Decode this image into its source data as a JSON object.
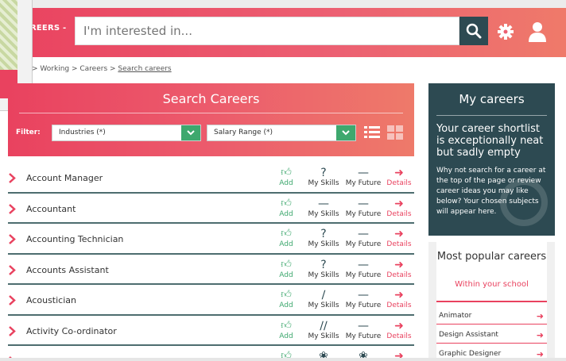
{
  "header": {
    "nav_label": "REERS -",
    "search_placeholder": "I'm interested in..."
  },
  "breadcrumb": {
    "text": "> Working > Careers > ",
    "current": "Search careers"
  },
  "search_panel": {
    "title": "Search Careers",
    "filter_label": "Filter:",
    "industries_select": "Industries (*)",
    "salary_select": "Salary Range (*)"
  },
  "careers": [
    {
      "name": "Account Manager",
      "skills": "?",
      "future": "—"
    },
    {
      "name": "Accountant",
      "skills": "—",
      "future": "—"
    },
    {
      "name": "Accounting Technician",
      "skills": "?",
      "future": "—"
    },
    {
      "name": "Accounts Assistant",
      "skills": "?",
      "future": "—"
    },
    {
      "name": "Acoustician",
      "skills": "∕",
      "future": "—"
    },
    {
      "name": "Activity Co-ordinator",
      "skills": "∕∕",
      "future": "—"
    },
    {
      "name": "",
      "skills": "❀",
      "future": "❀"
    }
  ],
  "row_labels": {
    "add": "Add",
    "skills": "My Skills",
    "future": "My Future",
    "details": "Details"
  },
  "my_careers": {
    "title": "My careers",
    "headline": "Your career shortlist is exceptionally neat but sadly empty",
    "body": "Why not search for a career at the top of the page or review career ideas you may like below? Your chosen subjects will appear here."
  },
  "popular": {
    "title": "Most popular careers",
    "subtitle": "Within your school",
    "items": [
      "Animator",
      "Design Assistant",
      "Graphic Designer"
    ]
  },
  "colors": {
    "brand_red": "#e9425f",
    "dark_teal": "#2d4a52",
    "green": "#3ea86e"
  }
}
